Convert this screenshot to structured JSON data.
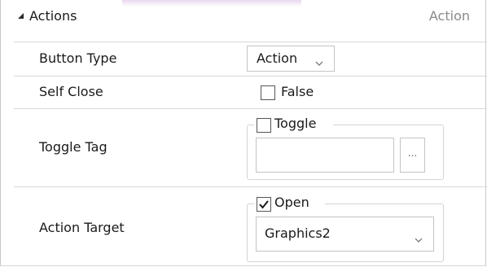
{
  "section": {
    "title": "Actions",
    "category": "Action",
    "expanded": true
  },
  "properties": {
    "button_type": {
      "label": "Button Type",
      "value": "Action"
    },
    "self_close": {
      "label": "Self Close",
      "checked": false,
      "value_text": "False"
    },
    "toggle_tag": {
      "label": "Toggle Tag",
      "checkbox_label": "Toggle",
      "checked": false,
      "tag_value": "",
      "browse_label": "..."
    },
    "action_target": {
      "label": "Action Target",
      "checkbox_label": "Open",
      "checked": true,
      "target_value": "Graphics2"
    }
  },
  "icons": {
    "expand": "collapse-triangle-icon",
    "dropdown": "chevron-down-icon",
    "check": "checkmark-icon"
  }
}
